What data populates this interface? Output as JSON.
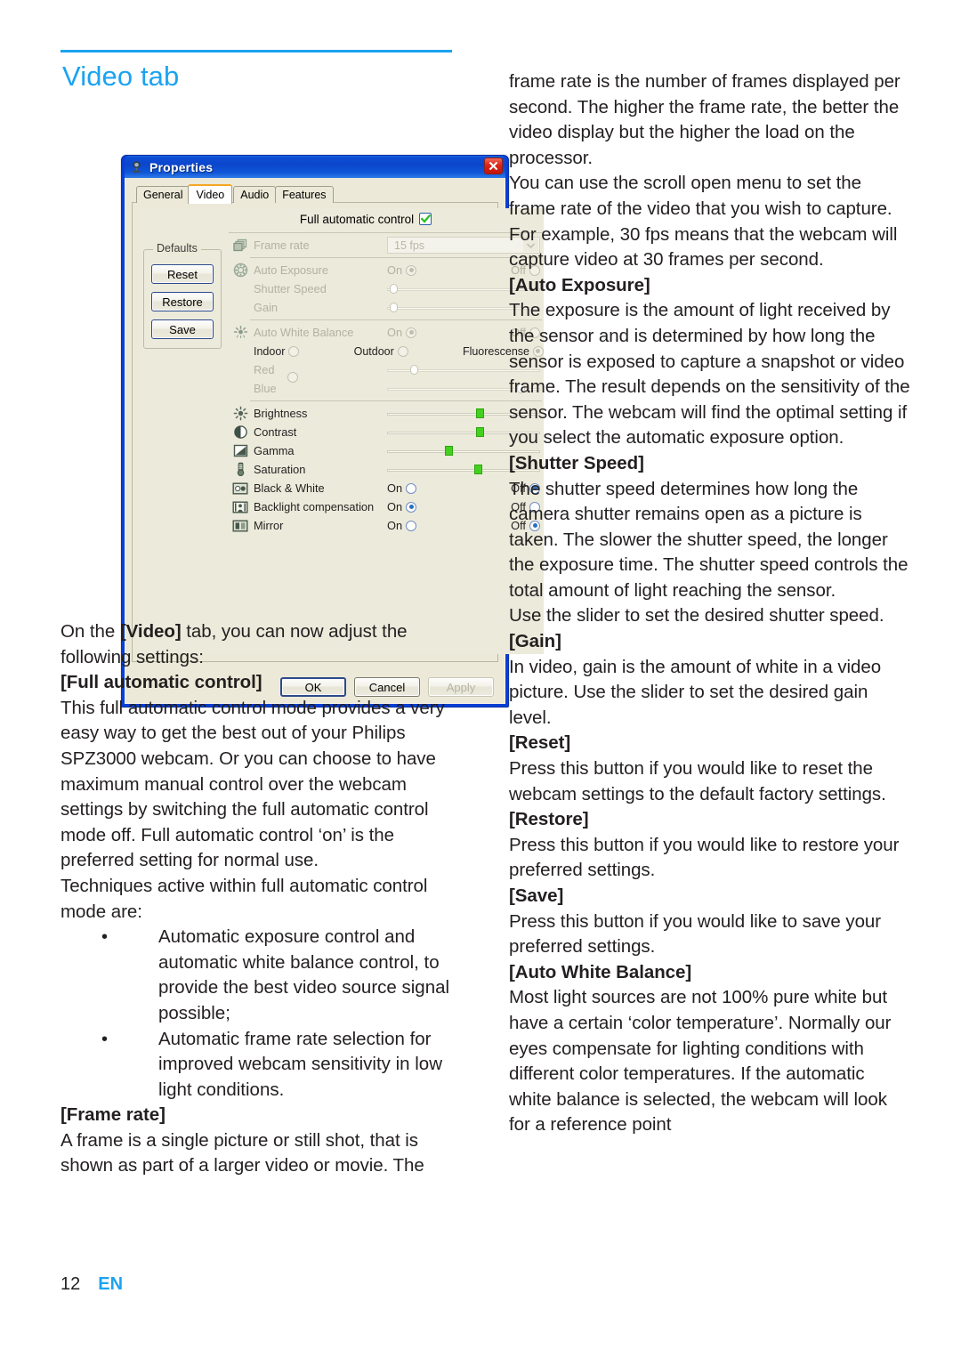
{
  "page": {
    "title": "Video tab",
    "number": "12",
    "language": "EN",
    "accent_color": "#1ca3f0"
  },
  "dialog": {
    "title": "Properties",
    "title_icon": "webcam-icon",
    "close_icon": "close-icon",
    "tabs": [
      {
        "label": "General",
        "active": false
      },
      {
        "label": "Video",
        "active": true
      },
      {
        "label": "Audio",
        "active": false
      },
      {
        "label": "Features",
        "active": false
      }
    ],
    "full_automatic_control": {
      "label": "Full automatic control",
      "checked": true
    },
    "defaults_group": {
      "legend": "Defaults",
      "buttons": [
        "Reset",
        "Restore",
        "Save"
      ]
    },
    "settings": [
      {
        "icon": "frames-icon",
        "label": "Frame rate",
        "control": "combo",
        "value": "15 fps",
        "disabled": true
      },
      {
        "icon": "aperture-icon",
        "label": "Auto Exposure",
        "control": "onoff",
        "on_label": "On",
        "off_label": "Off",
        "value": "On",
        "disabled": true
      },
      {
        "icon": "",
        "label": "Shutter Speed",
        "control": "slider",
        "percent": 2,
        "disabled": true
      },
      {
        "icon": "",
        "label": "Gain",
        "control": "slider",
        "percent": 2,
        "disabled": true
      },
      {
        "icon": "white-balance-icon",
        "label": "Auto White Balance",
        "control": "onoff",
        "on_label": "On",
        "off_label": "Off",
        "value": "On",
        "disabled": true
      },
      {
        "icon": "",
        "label": "",
        "control": "wb-modes",
        "options": [
          "Indoor",
          "Outdoor",
          "Fluorescense"
        ],
        "value": "Fluorescense",
        "disabled": true
      },
      {
        "icon": "",
        "label": "Red",
        "control": "slider",
        "percent": 15,
        "disabled": true
      },
      {
        "icon": "",
        "label": "Blue",
        "control": "slider",
        "percent": 85,
        "disabled": true
      },
      {
        "icon": "brightness-icon",
        "label": "Brightness",
        "control": "slider",
        "percent": 58,
        "disabled": false
      },
      {
        "icon": "contrast-icon",
        "label": "Contrast",
        "control": "slider",
        "percent": 58,
        "disabled": false
      },
      {
        "icon": "gamma-icon",
        "label": "Gamma",
        "control": "slider",
        "percent": 38,
        "disabled": false
      },
      {
        "icon": "saturation-icon",
        "label": "Saturation",
        "control": "slider",
        "percent": 57,
        "disabled": false
      },
      {
        "icon": "black-white-icon",
        "label": "Black & White",
        "control": "onoff",
        "on_label": "On",
        "off_label": "Off",
        "value": "Off",
        "disabled": false
      },
      {
        "icon": "backlight-icon",
        "label": "Backlight compensation",
        "control": "onoff",
        "on_label": "On",
        "off_label": "Off",
        "value": "On",
        "disabled": false
      },
      {
        "icon": "mirror-icon",
        "label": "Mirror",
        "control": "onoff",
        "on_label": "On",
        "off_label": "Off",
        "value": "Off",
        "disabled": false
      }
    ],
    "footer_buttons": [
      {
        "label": "OK",
        "style": "default"
      },
      {
        "label": "Cancel",
        "style": "normal"
      },
      {
        "label": "Apply",
        "style": "disabled"
      }
    ]
  },
  "left_column": {
    "intro": "On the [Video] tab, you can now adjust the following settings:",
    "intro_plain_1": "On the ",
    "intro_bold": "[Video]",
    "intro_plain_2": " tab, you can now adjust the following settings:",
    "heading_full_auto": "[Full automatic control]",
    "para_full_auto": "This full automatic control mode provides a very easy way to get the best out of your Philips SPZ3000 webcam. Or you can choose to have maximum manual control over the webcam settings by switching the full automatic control mode off. Full automatic control ‘on’ is the preferred setting for normal use.",
    "para_techniques": "Techniques active within full automatic control mode are:",
    "bullets": [
      "Automatic exposure control and automatic white balance control, to provide the best video source signal possible;",
      "Automatic frame rate selection for improved webcam sensitivity in low light conditions."
    ],
    "heading_frame_rate": "[Frame rate]",
    "para_frame_rate": "A frame is a single picture or still shot, that is shown as part of a larger video or movie. The"
  },
  "right_column": {
    "para_frame_rate_cont": "frame rate is the number of frames displayed per second. The higher the frame rate, the better the video display but the higher the load on the processor.",
    "para_scroll_menu": "You can use the scroll open menu to set the frame rate of the video that you wish to capture. For example, 30 fps means that the webcam will capture video at 30 frames per second.",
    "heading_auto_exposure": "[Auto Exposure]",
    "para_auto_exposure": "The exposure is the amount of light received by the sensor and is determined by how long the sensor is exposed to capture a snapshot or video frame. The result depends on the sensitivity of the sensor. The webcam will find the optimal setting if you select the automatic exposure option.",
    "heading_shutter_speed": "[Shutter Speed]",
    "para_shutter_speed": "The shutter speed determines how long the camera shutter remains open as a picture is taken. The slower the shutter speed, the longer the exposure time. The shutter speed controls the total amount of light reaching the sensor.",
    "para_shutter_slider": "Use the slider to set the desired shutter speed.",
    "heading_gain": "[Gain]",
    "para_gain": "In video, gain is the amount of white in a video picture. Use the slider to set the desired gain level.",
    "heading_reset": "[Reset]",
    "para_reset": "Press this button if you would like to reset the webcam settings to the default factory settings.",
    "heading_restore": "[Restore]",
    "para_restore": "Press this button if you would like to restore your preferred settings.",
    "heading_save": "[Save]",
    "para_save": "Press this button if you would like to save your preferred settings.",
    "heading_auto_wb": "[Auto White Balance]",
    "para_auto_wb": "Most light sources are not 100% pure white but have a certain ‘color temperature’. Normally our eyes compensate for lighting conditions with different color temperatures. If the automatic white balance is selected, the webcam will look for a reference point"
  }
}
